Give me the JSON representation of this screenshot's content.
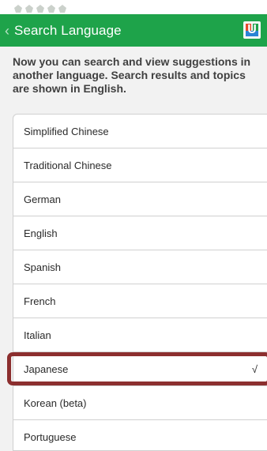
{
  "header": {
    "back_icon": "chevron-left-icon",
    "title": "Search Language",
    "logo_icon": "app-logo-icon",
    "logo_letter": "U",
    "colors": {
      "header_bg": "#1ea34a",
      "title": "#ffffff"
    }
  },
  "description": "Now you can search and view suggestions in another language. Search results and topics are shown in English.",
  "languages": [
    {
      "label": "Simplified Chinese",
      "selected": false
    },
    {
      "label": "Traditional Chinese",
      "selected": false
    },
    {
      "label": "German",
      "selected": false
    },
    {
      "label": "English",
      "selected": false
    },
    {
      "label": "Spanish",
      "selected": false
    },
    {
      "label": "French",
      "selected": false
    },
    {
      "label": "Italian",
      "selected": false
    },
    {
      "label": "Japanese",
      "selected": true,
      "check": "√"
    },
    {
      "label": "Korean (beta)",
      "selected": false
    },
    {
      "label": "Portuguese",
      "selected": false
    }
  ],
  "colors": {
    "page_bg": "#f2f2f2",
    "list_bg": "#ffffff",
    "divider": "#d0d0d0",
    "selection_outline": "#8c2f2f"
  }
}
